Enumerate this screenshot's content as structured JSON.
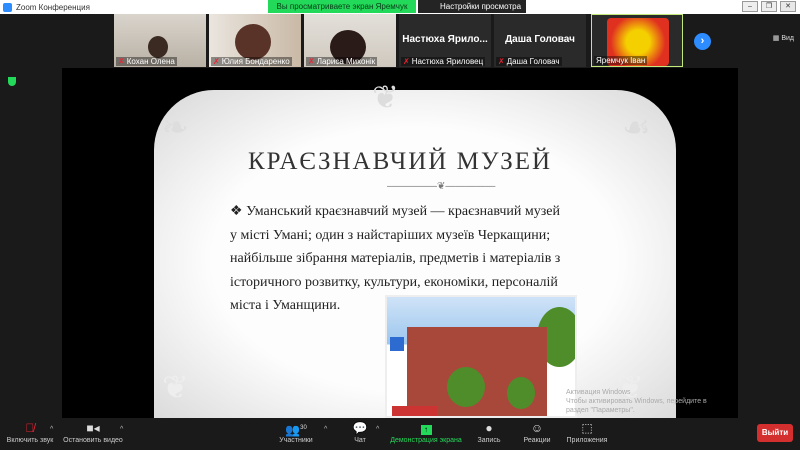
{
  "window": {
    "title": "Zoom Конференция"
  },
  "banner": {
    "sharing": "Вы просматриваете экран Яремчук Іван",
    "view_options": "Настройки просмотра ⌄"
  },
  "participants": [
    {
      "name": "Кохан Олена",
      "video": true
    },
    {
      "name": "Юлия Бондаренко",
      "video": true
    },
    {
      "name": "Лариса Михонік",
      "video": true
    },
    {
      "name": "Настюха Яриловец",
      "display": "Настюха  Ярило...",
      "video": false
    },
    {
      "name": "Даша Головач",
      "display": "Даша Головач",
      "video": false
    },
    {
      "name": "Яремчук Іван",
      "video": true,
      "active": true
    }
  ],
  "view_button": "Вид",
  "slide": {
    "title": "КРАЄЗНАВЧИЙ МУЗЕЙ",
    "bullet": "❖",
    "text": "Уманський краєзнавчий музей — краєзнавчий музей у місті Умані; один з найстаріших музеїв Черкащини; найбільше зібрання матеріалів, предметів і матеріалів з історичного розвитку, культури, економіки, персоналій міста і Уманщини."
  },
  "watermark": {
    "line1": "Активация Windows",
    "line2": "Чтобы активировать Windows, перейдите в раздел \"Параметры\"."
  },
  "toolbar": {
    "unmute": "Включить звук",
    "stop_video": "Остановить видео",
    "participants": "Участники",
    "participants_count": "30",
    "chat": "Чат",
    "share": "Демонстрация экрана",
    "record": "Запись",
    "reactions": "Реакции",
    "apps": "Приложения",
    "leave": "Выйти"
  },
  "colors": {
    "share_green": "#23d959",
    "leave_red": "#d32f2f",
    "accent": "#2d8cff"
  }
}
